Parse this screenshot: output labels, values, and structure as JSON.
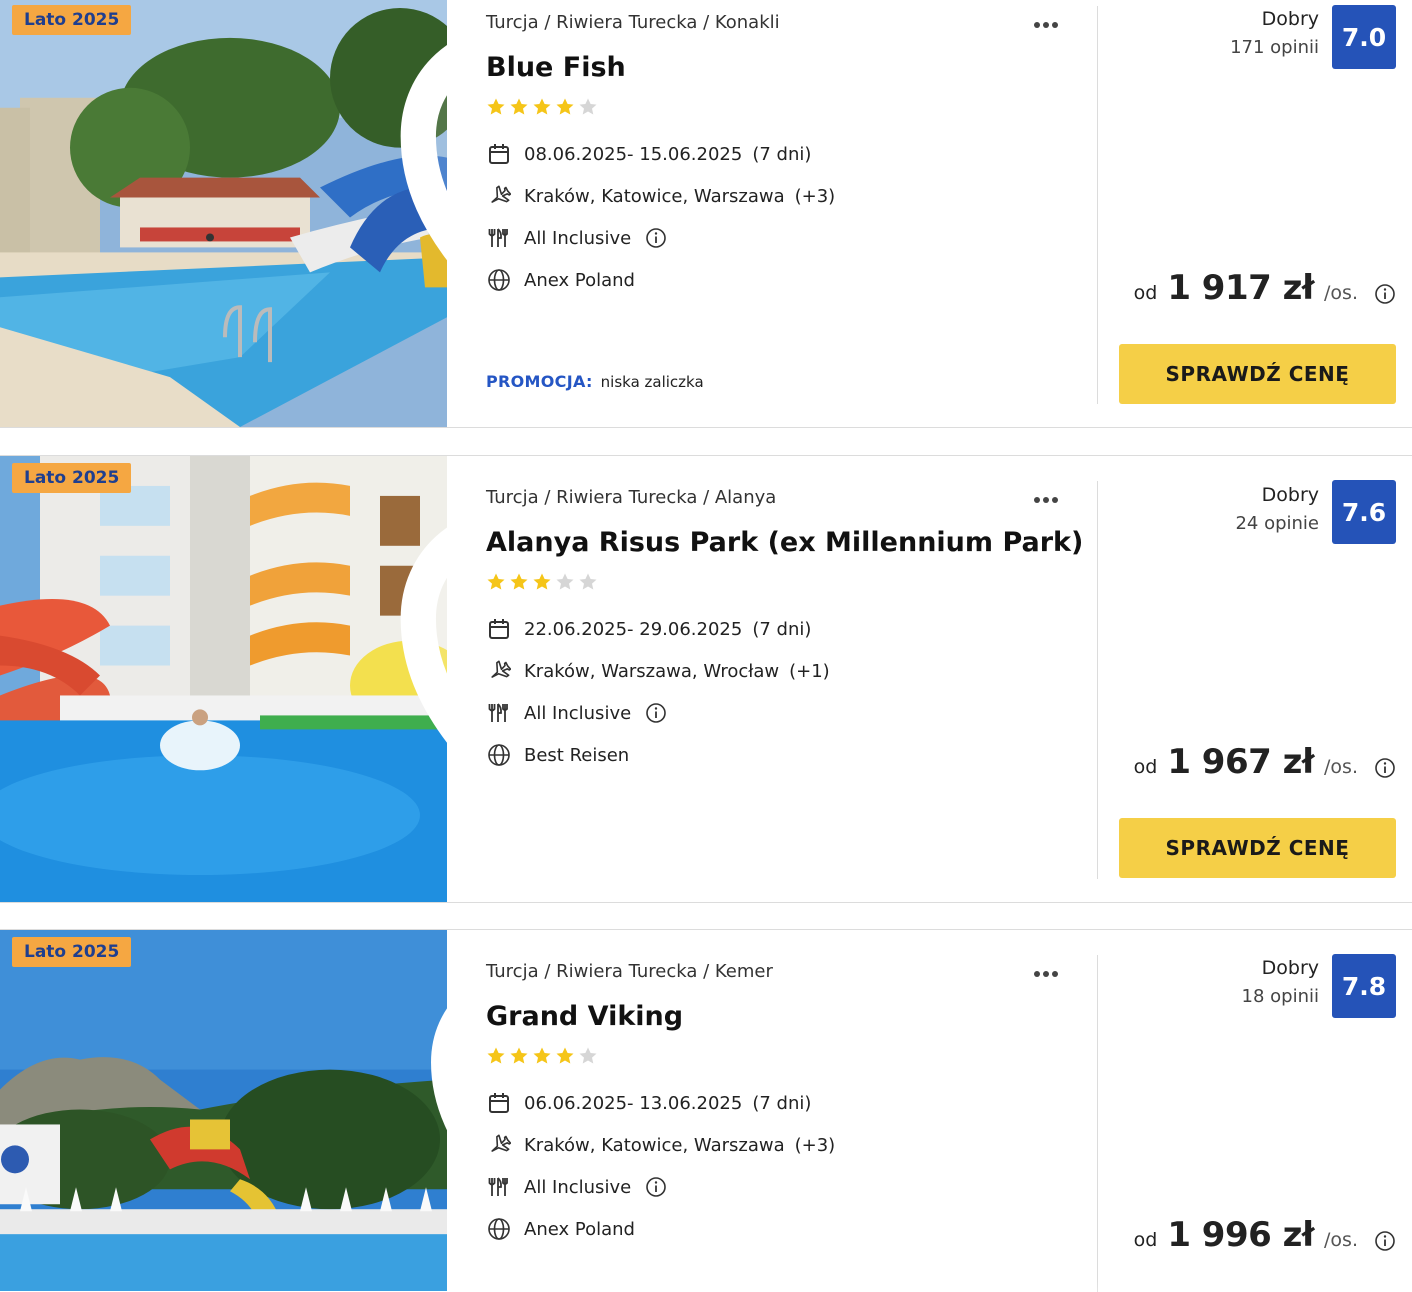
{
  "offers": [
    {
      "badge": "Lato 2025",
      "breadcrumb": "Turcja / Riwiera Turecka / Konakli",
      "name": "Blue Fish",
      "stars": 4,
      "dates": "08.06.2025- 15.06.2025",
      "duration": "(7 dni)",
      "departures": "Kraków, Katowice, Warszawa",
      "departures_more": "(+3)",
      "board": "All Inclusive",
      "operator": "Anex Poland",
      "promo_label": "PROMOCJA:",
      "promo_text": "niska zaliczka",
      "rating_word": "Dobry",
      "reviews": "171 opinii",
      "score": "7.0",
      "price_prefix": "od",
      "price": "1 917 zł",
      "price_suffix": "/os.",
      "cta": "SPRAWDŹ CENĘ"
    },
    {
      "badge": "Lato 2025",
      "breadcrumb": "Turcja / Riwiera Turecka / Alanya",
      "name": "Alanya Risus Park (ex Millennium Park)",
      "stars": 3,
      "dates": "22.06.2025- 29.06.2025",
      "duration": "(7 dni)",
      "departures": "Kraków, Warszawa, Wrocław",
      "departures_more": "(+1)",
      "board": "All Inclusive",
      "operator": "Best Reisen",
      "rating_word": "Dobry",
      "reviews": "24 opinie",
      "score": "7.6",
      "price_prefix": "od",
      "price": "1 967 zł",
      "price_suffix": "/os.",
      "cta": "SPRAWDŹ CENĘ"
    },
    {
      "badge": "Lato 2025",
      "breadcrumb": "Turcja / Riwiera Turecka / Kemer",
      "name": "Grand Viking",
      "stars": 4,
      "dates": "06.06.2025- 13.06.2025",
      "duration": "(7 dni)",
      "departures": "Kraków, Katowice, Warszawa",
      "departures_more": "(+3)",
      "board": "All Inclusive",
      "operator": "Anex Poland",
      "rating_word": "Dobry",
      "reviews": "18 opinii",
      "score": "7.8",
      "price_prefix": "od",
      "price": "1 996 zł",
      "price_suffix": "/os."
    }
  ],
  "icons": {
    "calendar": "calendar-icon",
    "plane": "plane-icon",
    "cutlery": "cutlery-icon",
    "globe": "globe-icon",
    "info": "info-icon",
    "heart": "heart-icon",
    "more": "more-dots-icon",
    "star": "star-icon"
  },
  "colors": {
    "badge_bg": "#f5a742",
    "badge_text": "#1f3f8f",
    "score_bg": "#2553b8",
    "cta_bg": "#f5cf47",
    "star_on": "#f5c518",
    "star_off": "#d6d6d6",
    "promo": "#2556c4"
  }
}
